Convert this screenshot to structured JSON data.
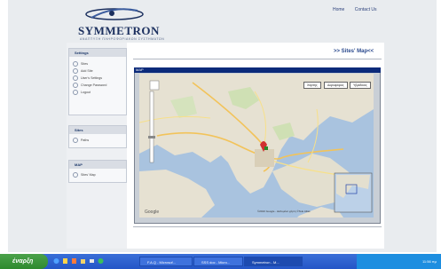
{
  "header": {
    "brand": "SYMMETRON",
    "brand_sub": "ΑΝΑΠΤΥΞΗ ΠΛΗΡΟΦΟΡΙΑΚΩΝ ΣΥΣΤΗΜΑΤΩΝ",
    "links": [
      "Home",
      "Contact Us"
    ]
  },
  "sidebar": {
    "settings": {
      "title": "Settings",
      "items": [
        "Sites",
        "Add Site",
        "User's Settings",
        "Change Password",
        "Logout"
      ]
    },
    "sites": {
      "title": "Sites",
      "items": [
        "Paths"
      ]
    },
    "map": {
      "title": "MAP",
      "items": [
        "Sites' Map"
      ]
    }
  },
  "main": {
    "title": ">> Sites' Map<<",
    "map_window_title": "MAP",
    "map_buttons": [
      "Χάρτης",
      "Δορυφόρος",
      "Υβριδικός"
    ],
    "copyright": "©2010 Google - Δεδομένα χάρτη ©Tele Atlas"
  },
  "taskbar": {
    "start_label": "έναρξη",
    "items": [
      "F.A.Q - Microsof...",
      "SSS doc - Micro...",
      "Symmetron - M..."
    ],
    "clock": "11:56 πμ"
  },
  "colors": {
    "brand": "#1b2f5e",
    "map_titlebar": "#0b2a7a",
    "taskbar": "#2456c7",
    "start_button": "#2e8a2e"
  }
}
